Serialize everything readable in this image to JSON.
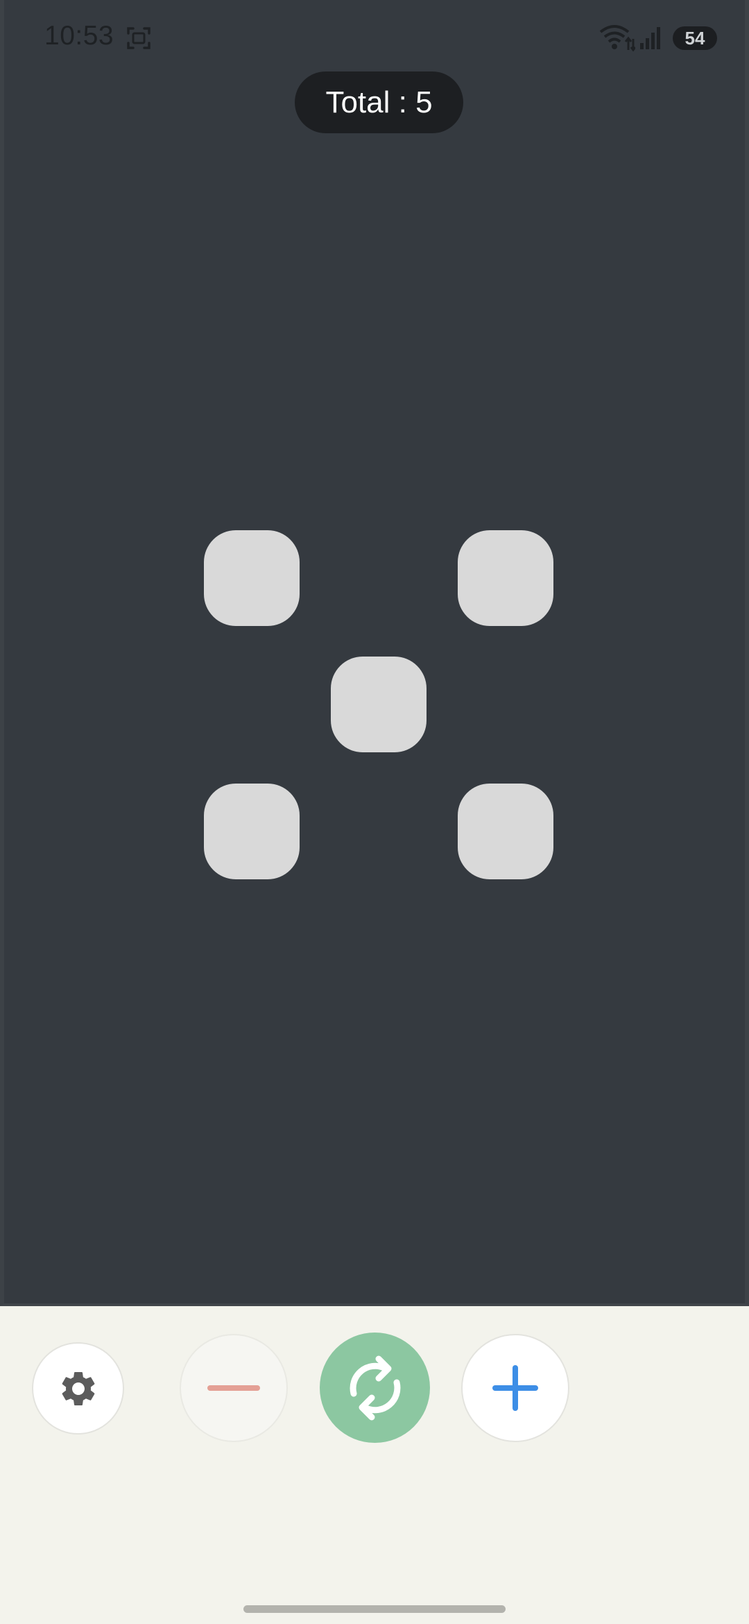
{
  "status_bar": {
    "time": "10:53",
    "battery": "54",
    "icons": [
      "screenshot-icon",
      "wifi-icon",
      "signal-icon"
    ]
  },
  "game": {
    "total_label": "Total : 5",
    "dice_count": 5,
    "die_color": "#d9d9d9",
    "board_color": "#353a40"
  },
  "controls": {
    "settings_icon": "gear-icon",
    "minus_icon": "minus-icon",
    "roll_icon": "refresh-icon",
    "plus_icon": "plus-icon",
    "minus_color": "#e4a095",
    "roll_color": "#8cc7a1",
    "plus_color": "#3d8ee6",
    "gear_color": "#5c5c5c"
  }
}
